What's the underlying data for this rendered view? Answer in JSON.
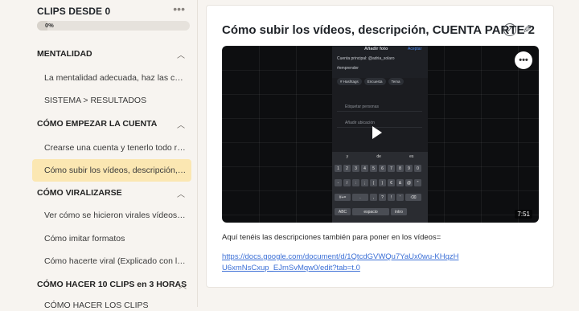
{
  "sidebar": {
    "course_title": "CLIPS DESDE 0",
    "more_icon": "more-horizontal-icon",
    "progress": {
      "label": "0%",
      "value": 0.07
    },
    "sections": [
      {
        "label": "MENTALIDAD",
        "lessons": [
          "La mentalidad adecuada, haz las cosas ...",
          "SISTEMA > RESULTADOS"
        ]
      },
      {
        "label": "CÓMO EMPEZAR LA CUENTA",
        "lessons": [
          "Crearse una cuenta y tenerlo todo regist...",
          "Cómo subir los vídeos, descripción, CUE..."
        ]
      },
      {
        "label": "CÓMO VIRALIZARSE",
        "lessons": [
          "Ver cómo se hicieron virales vídeos(o no)",
          "Cómo imitar formatos",
          "Cómo hacerte viral (Explicado con la Es..."
        ]
      },
      {
        "label": "CÓMO HACER 10 CLIPS en 3 HORAS",
        "lessons": [
          "CÓMO HACER LOS CLIPS"
        ]
      }
    ],
    "active_lesson": "Cómo subir los vídeos, descripción, CUE..."
  },
  "main": {
    "title": "Cómo subir los vídeos, descripción, CUENTA PARTE 2",
    "check_icon": "check-circle-icon",
    "edit_icon": "pencil-icon",
    "video": {
      "duration": "7:51",
      "menu_icon": "more-horizontal-icon",
      "phone": {
        "header_title": "Añadir foto",
        "header_action": "Aceptar",
        "account_line": "Cuenta principal: @adria_solaro",
        "hashtag": "#emprender",
        "chips": [
          "# Hashtags",
          "Encuesta",
          "Tema"
        ],
        "rows": [
          "Etiquetar personas",
          "Añadir ubicación"
        ],
        "suggestions": [
          "y",
          "de",
          "es"
        ],
        "keyboard_rows": [
          [
            "1",
            "2",
            "3",
            "4",
            "5",
            "6",
            "7",
            "8",
            "9",
            "0"
          ],
          [
            "-",
            "/",
            ":",
            ";",
            "(",
            ")",
            "€",
            "&",
            "@",
            "\""
          ],
          [
            "#+=",
            ".",
            ",",
            "?",
            "!",
            "'",
            "⌫"
          ],
          [
            "ABC",
            "espacio",
            "intro"
          ]
        ]
      }
    },
    "description": "Aquí tenéis las descripciones también para poner en los vídeos=",
    "link": "https://docs.google.com/document/d/1QtcdGVWQu7YaUx0wu-KHqzHU6xmNsCxup_EJmSvMqw0/edit?tab=t.0"
  }
}
